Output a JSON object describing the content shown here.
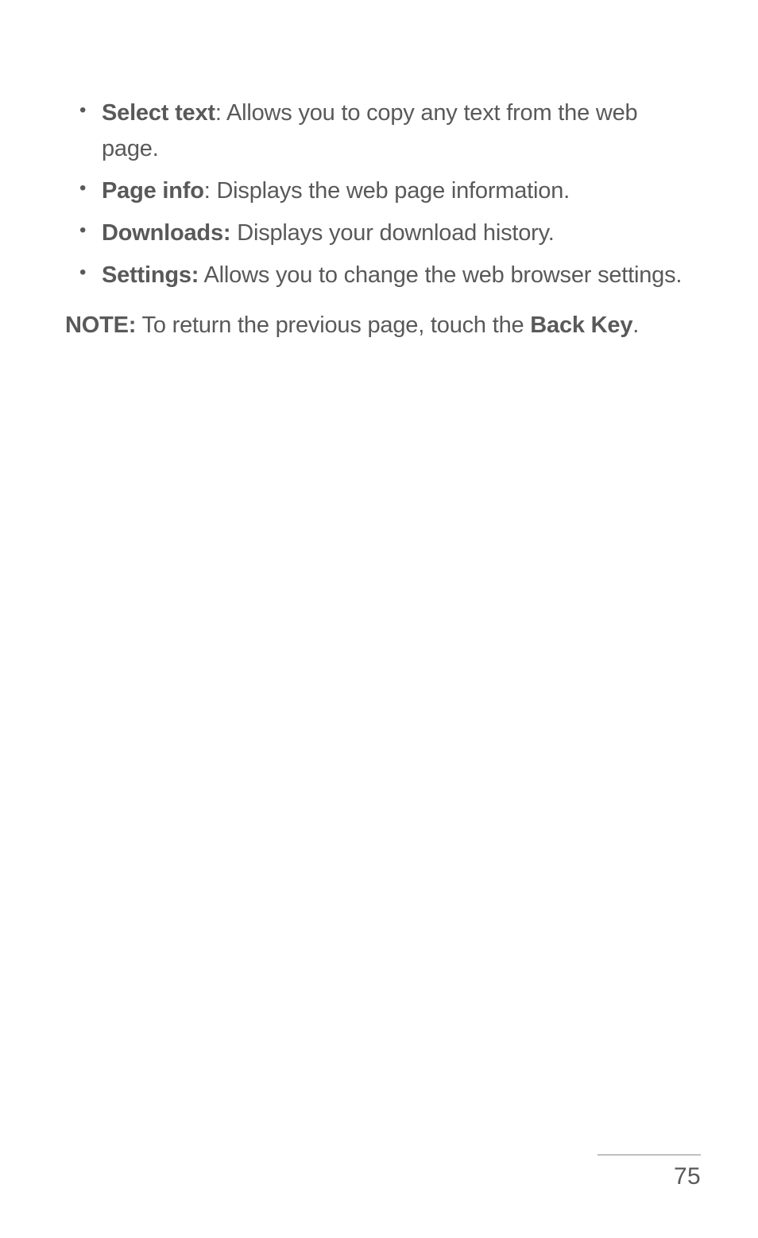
{
  "bullets": [
    {
      "term": "Select text",
      "sep": ": ",
      "desc": "Allows you to copy any text from the web page."
    },
    {
      "term": "Page info",
      "sep": ": ",
      "desc": "Displays the web page information."
    },
    {
      "term": "Downloads:",
      "sep": " ",
      "desc": "Displays your download history."
    },
    {
      "term": "Settings:",
      "sep": " ",
      "desc": "Allows you to change the web browser settings."
    }
  ],
  "note": {
    "label": "NOTE:",
    "before": " To return the previous page, touch the ",
    "key": "Back Key",
    "after": "."
  },
  "page_number": "75"
}
